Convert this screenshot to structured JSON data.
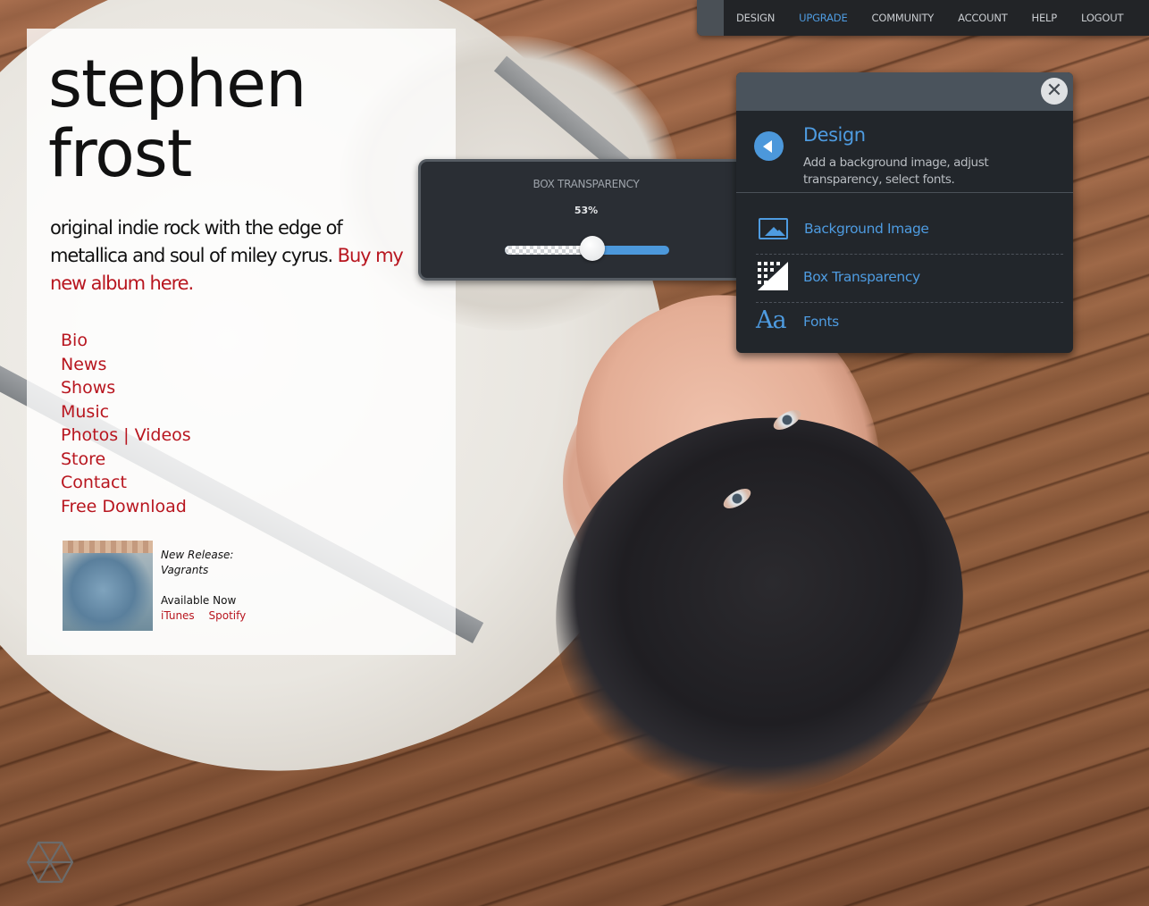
{
  "site": {
    "title_line1": "stephen",
    "title_line2": "frost",
    "tagline": "original indie rock with the edge of metallica and soul of miley cyrus.",
    "tagline_link": "Buy my new album here.",
    "nav": [
      "Bio",
      "News",
      "Shows",
      "Music",
      "Photos | Videos",
      "Store",
      "Contact",
      "Free Download"
    ],
    "release": {
      "label": "New Release:",
      "album": "Vagrants",
      "availability": "Available Now",
      "links": [
        "iTunes",
        "Spotify"
      ]
    }
  },
  "topbar": {
    "items": [
      "DESIGN",
      "UPGRADE",
      "COMMUNITY",
      "ACCOUNT",
      "HELP",
      "LOGOUT"
    ],
    "active": "UPGRADE"
  },
  "slider": {
    "title": "BOX TRANSPARENCY",
    "value_label": "53%",
    "value": 0.53
  },
  "design_panel": {
    "title": "Design",
    "description": "Add a background image, adjust transparency, select fonts.",
    "options": [
      {
        "label": "Background Image",
        "icon": "image-icon"
      },
      {
        "label": "Box Transparency",
        "icon": "transparency-icon"
      },
      {
        "label": "Fonts",
        "icon": "fonts-icon"
      }
    ],
    "icons": {
      "close": "close-icon",
      "back": "back-arrow-icon"
    },
    "fonts_icon_glyph": "Aa"
  },
  "colors": {
    "accent_blue": "#4e9be0",
    "link_red": "#b8161f",
    "panel_bg": "#22262b",
    "topbar_bg": "#222427"
  }
}
